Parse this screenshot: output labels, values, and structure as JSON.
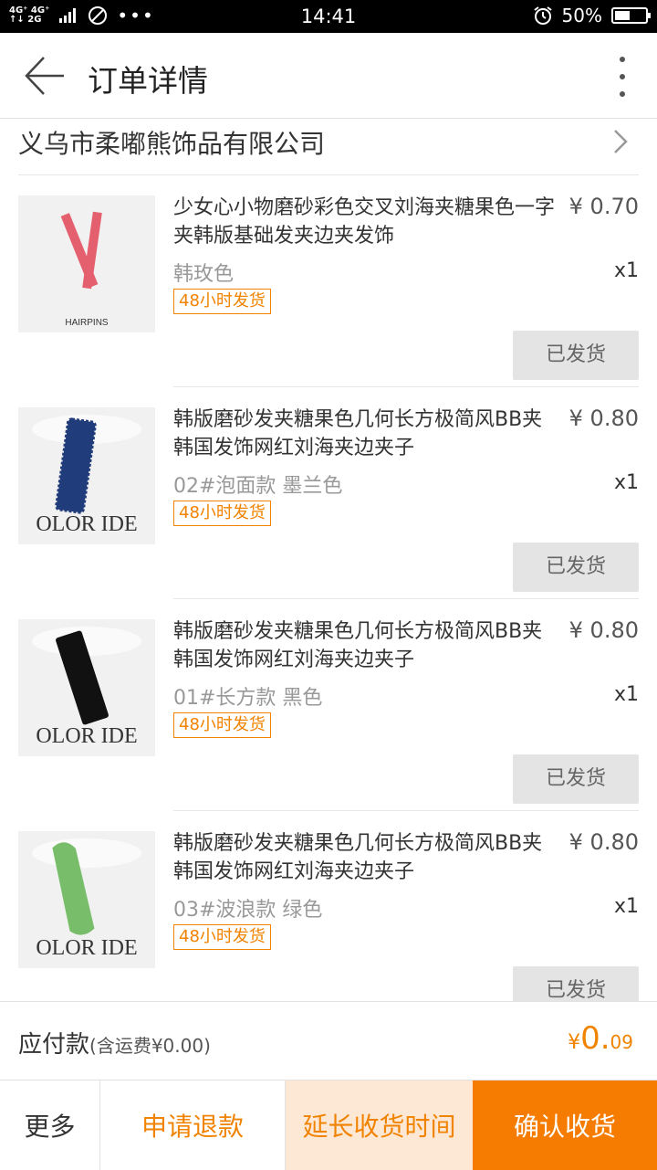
{
  "status_bar": {
    "network": "4G⁺ 4G⁺\n2G",
    "time": "14:41",
    "battery_text": "50%",
    "battery_level": 0.5
  },
  "header": {
    "title": "订单详情"
  },
  "shop": {
    "name": "义乌市柔嘟熊饰品有限公司"
  },
  "items": [
    {
      "name": "少女心小物磨砂彩色交叉刘海夹糖果色一字夹韩版基础发夹边夹发饰",
      "price": "¥ 0.70",
      "variant": "韩玫色",
      "qty": "x1",
      "tag": "48小时发货",
      "status": "已发货",
      "thumb_text": "HAIRPINS",
      "thumb_color": "#e4606e"
    },
    {
      "name": "韩版磨砂发夹糖果色几何长方极简风BB夹韩国发饰网红刘海夹边夹子",
      "price": "¥ 0.80",
      "variant": "02#泡面款 墨兰色",
      "qty": "x1",
      "tag": "48小时发货",
      "status": "已发货",
      "thumb_text": "OLOR IDE",
      "thumb_color": "#213c7a"
    },
    {
      "name": "韩版磨砂发夹糖果色几何长方极简风BB夹韩国发饰网红刘海夹边夹子",
      "price": "¥ 0.80",
      "variant": "01#长方款 黑色",
      "qty": "x1",
      "tag": "48小时发货",
      "status": "已发货",
      "thumb_text": "OLOR IDE",
      "thumb_color": "#111111"
    },
    {
      "name": "韩版磨砂发夹糖果色几何长方极简风BB夹韩国发饰网红刘海夹边夹子",
      "price": "¥ 0.80",
      "variant": "03#波浪款 绿色",
      "qty": "x1",
      "tag": "48小时发货",
      "status": "已发货",
      "thumb_text": "OLOR IDE",
      "thumb_color": "#78bd6a"
    }
  ],
  "total": {
    "label": "应付款",
    "sub": "(含运费¥0.00)",
    "amount_symbol": "¥",
    "amount_int": "0.",
    "amount_dec": "09"
  },
  "actions": {
    "more": "更多",
    "refund": "申请退款",
    "extend": "延长收货时间",
    "confirm": "确认收货"
  },
  "colors": {
    "accent": "#f08300",
    "confirm_bg": "#f57c00",
    "extend_bg": "#fde7d5"
  }
}
